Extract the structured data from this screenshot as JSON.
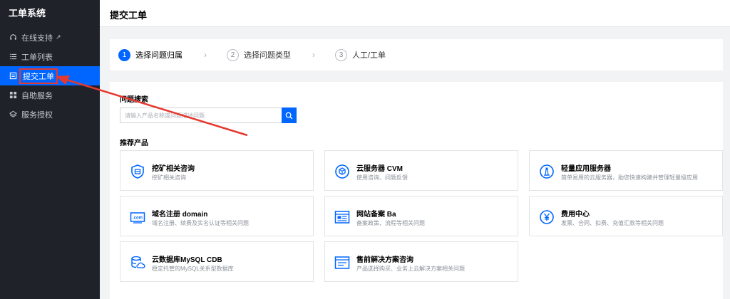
{
  "sidebar": {
    "brand": "工单系统",
    "items": [
      {
        "label": "在线支持",
        "icon": "headset-icon",
        "external": "↗"
      },
      {
        "label": "工单列表",
        "icon": "list-icon"
      },
      {
        "label": "提交工单",
        "icon": "document-icon"
      },
      {
        "label": "自助服务",
        "icon": "grid-icon"
      },
      {
        "label": "服务授权",
        "icon": "layers-icon"
      }
    ]
  },
  "header": {
    "title": "提交工单"
  },
  "steps": [
    {
      "num": "1",
      "label": "选择问题归属"
    },
    {
      "num": "2",
      "label": "选择问题类型"
    },
    {
      "num": "3",
      "label": "人工/工单"
    }
  ],
  "step_separator": "›",
  "search": {
    "title": "问题搜索",
    "placeholder": "请输入产品名称或问题描述问题"
  },
  "products": {
    "title": "推荐产品",
    "items": [
      {
        "title": "挖矿相关咨询",
        "desc": "挖矿相关咨询",
        "icon": "shield-icon"
      },
      {
        "title": "云服务器 CVM",
        "desc": "使用咨询、问题反馈",
        "icon": "cube-icon"
      },
      {
        "title": "轻量应用服务器",
        "desc": "简单易用的云服务器，助您快速构建并管理轻量级应用",
        "icon": "lighthouse-icon"
      },
      {
        "title": "域名注册 domain",
        "desc": "域名注册、续费及实名认证等相关问题",
        "icon": "dotcom-icon"
      },
      {
        "title": "网站备案 Ba",
        "desc": "备案政策、流程等相关问题",
        "icon": "webpage-icon"
      },
      {
        "title": "费用中心",
        "desc": "发票、合同、扣费、充值汇款等相关问题",
        "icon": "yen-icon"
      },
      {
        "title": "云数据库MySQL CDB",
        "desc": "稳定托管的MySQL关系型数据库",
        "icon": "database-icon"
      },
      {
        "title": "售前解决方案咨询",
        "desc": "产品选择购买、业务上云解决方案相关问题",
        "icon": "solution-icon"
      }
    ]
  },
  "colors": {
    "accent": "#0066ff",
    "sidebar": "#1f2229",
    "annotation": "#e5392f"
  }
}
